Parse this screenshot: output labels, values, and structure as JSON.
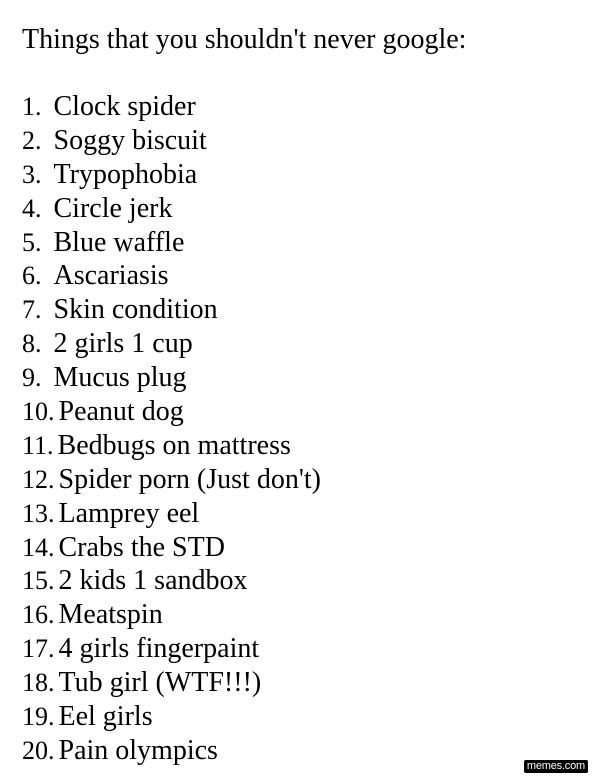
{
  "title": "Things that you shouldn't never google:",
  "items": [
    {
      "number": "1.",
      "text": "Clock spider"
    },
    {
      "number": "2.",
      "text": "Soggy biscuit"
    },
    {
      "number": "3.",
      "text": "Trypophobia"
    },
    {
      "number": "4.",
      "text": "Circle jerk"
    },
    {
      "number": "5.",
      "text": "Blue waffle"
    },
    {
      "number": "6.",
      "text": "Ascariasis"
    },
    {
      "number": "7.",
      "text": "Skin condition"
    },
    {
      "number": "8.",
      "text": "2 girls 1 cup"
    },
    {
      "number": "9.",
      "text": "Mucus plug"
    },
    {
      "number": "10.",
      "text": "Peanut dog"
    },
    {
      "number": "11.",
      "text": "Bedbugs on mattress"
    },
    {
      "number": "12.",
      "text": "Spider porn (Just don't)"
    },
    {
      "number": "13.",
      "text": "Lamprey eel"
    },
    {
      "number": "14.",
      "text": "Crabs the STD"
    },
    {
      "number": "15.",
      "text": "2 kids 1 sandbox"
    },
    {
      "number": "16.",
      "text": "Meatspin"
    },
    {
      "number": "17.",
      "text": "4 girls fingerpaint"
    },
    {
      "number": "18.",
      "text": "Tub girl (WTF!!!)"
    },
    {
      "number": "19.",
      "text": "Eel girls"
    },
    {
      "number": "20.",
      "text": "Pain olympics"
    }
  ],
  "watermark": "memes.com"
}
